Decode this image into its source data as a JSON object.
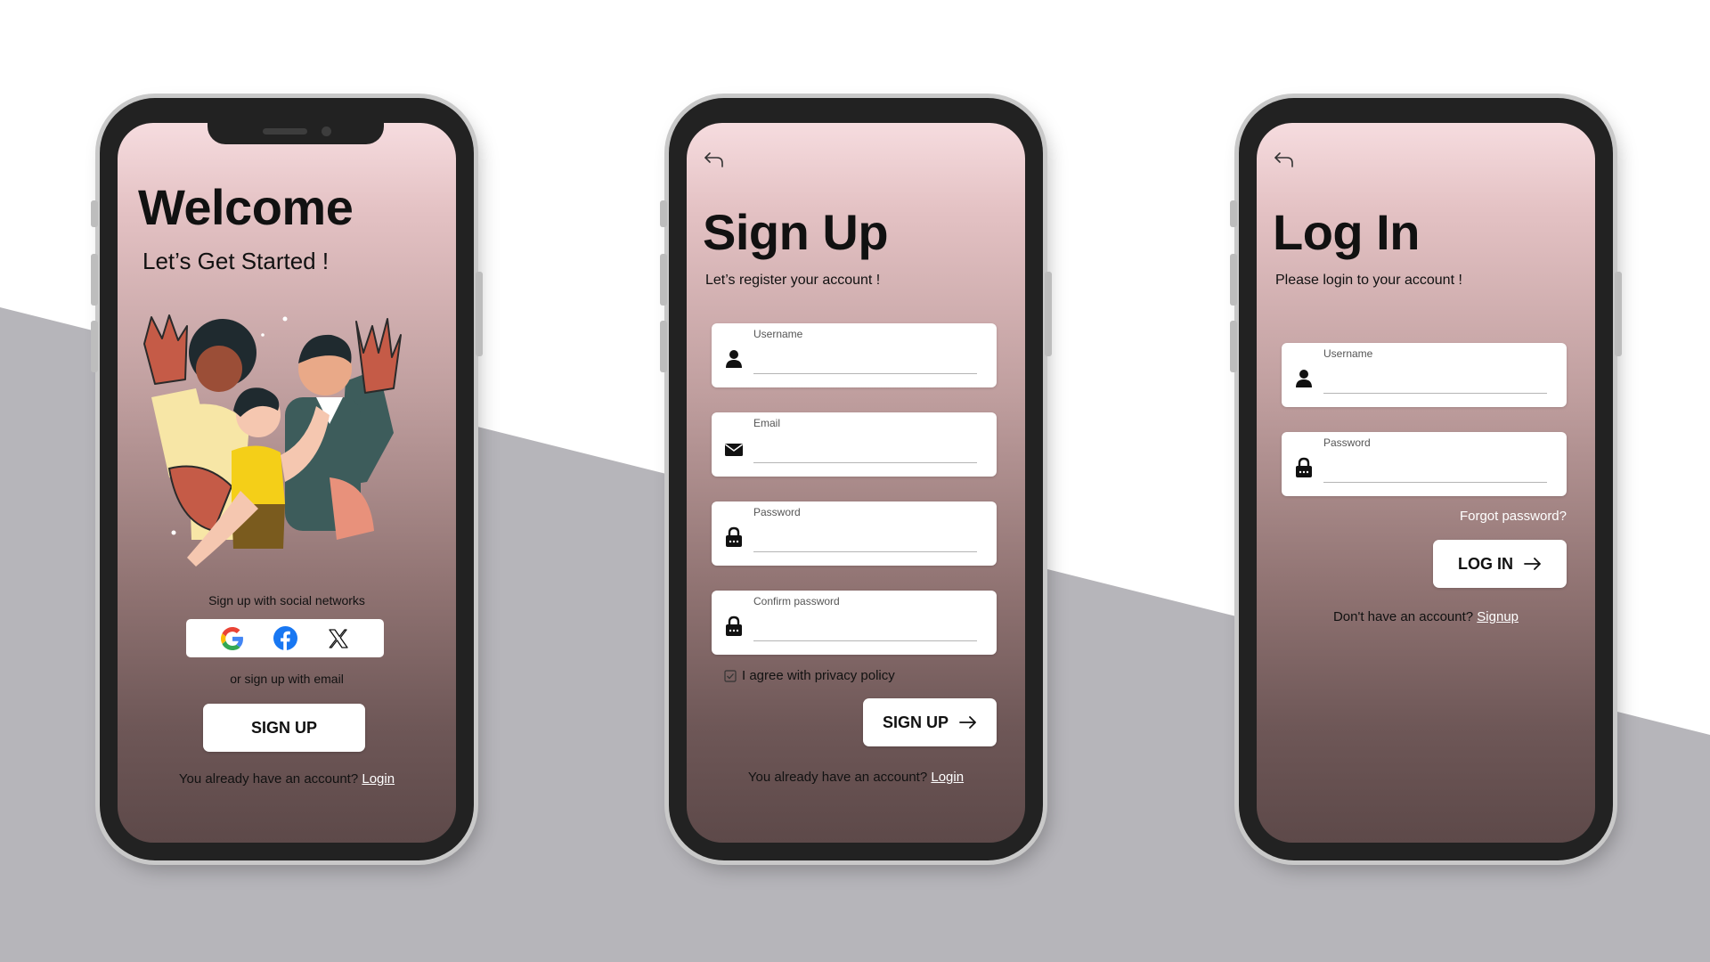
{
  "welcome": {
    "title": "Welcome",
    "subtitle": "Let’s Get Started !",
    "social_prompt": "Sign up with social networks",
    "social_icons": [
      "google-icon",
      "facebook-icon",
      "x-icon"
    ],
    "email_prompt": "or sign up with email",
    "signup_button": "SIGN UP",
    "footer_text": "You already have an account?",
    "footer_link": "Login"
  },
  "signup": {
    "title": "Sign Up",
    "subtitle": "Let’s register your account !",
    "fields": [
      {
        "label": "Username",
        "icon": "user-icon"
      },
      {
        "label": "Email",
        "icon": "envelope-icon"
      },
      {
        "label": "Password",
        "icon": "lock-icon"
      },
      {
        "label": "Confirm password",
        "icon": "lock-icon"
      }
    ],
    "agree_label": "I agree with privacy policy",
    "agree_checked": true,
    "button": "SIGN UP",
    "footer_text": "You already have an account?",
    "footer_link": "Login"
  },
  "login": {
    "title": "Log In",
    "subtitle": "Please login to your account !",
    "fields": [
      {
        "label": "Username",
        "icon": "user-icon"
      },
      {
        "label": "Password",
        "icon": "lock-icon"
      }
    ],
    "forgot": "Forgot password?",
    "button": "LOG IN",
    "footer_text": "Don't have an account?",
    "footer_link": "Signup"
  },
  "colors": {
    "backdrop_gray": "#b6b5ba",
    "gradient_top": "#f6dcdf",
    "gradient_bottom": "#5d4949",
    "google_blue": "#4285F4",
    "facebook_blue": "#1877F2"
  }
}
